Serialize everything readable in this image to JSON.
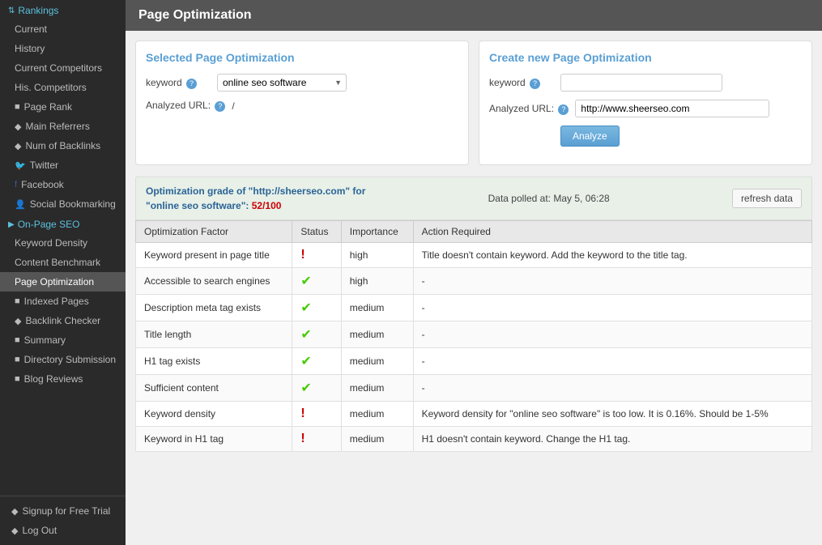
{
  "sidebar": {
    "rankings_label": "Rankings",
    "current_label": "Current",
    "history_label": "History",
    "current_competitors_label": "Current Competitors",
    "his_competitors_label": "His. Competitors",
    "page_rank_label": "Page Rank",
    "main_referrers_label": "Main Referrers",
    "num_backlinks_label": "Num of Backlinks",
    "twitter_label": "Twitter",
    "facebook_label": "Facebook",
    "social_bookmarking_label": "Social Bookmarking",
    "onpage_seo_label": "On-Page SEO",
    "keyword_density_label": "Keyword Density",
    "content_benchmark_label": "Content Benchmark",
    "page_optimization_label": "Page Optimization",
    "indexed_pages_label": "Indexed Pages",
    "backlink_checker_label": "Backlink Checker",
    "summary_label": "Summary",
    "directory_submission_label": "Directory Submission",
    "blog_reviews_label": "Blog Reviews",
    "signup_label": "Signup for Free Trial",
    "logout_label": "Log Out"
  },
  "page_header": "Page Optimization",
  "selected_panel": {
    "title": "Selected Page Optimization",
    "keyword_label": "keyword",
    "keyword_value": "online seo software",
    "analyzed_url_label": "Analyzed URL:",
    "analyzed_url_value": "/"
  },
  "create_panel": {
    "title": "Create new Page Optimization",
    "keyword_label": "keyword",
    "keyword_placeholder": "",
    "analyzed_url_label": "Analyzed URL:",
    "analyzed_url_value": "http://www.sheerseo.com",
    "analyze_btn": "Analyze"
  },
  "grade_section": {
    "grade_line1": "Optimization grade of \"http://sheerseo.com\" for",
    "grade_line2_pre": "\"online seo software\": ",
    "grade_score": "52/100",
    "poll_label": "Data polled at: May 5, 06:28",
    "refresh_btn": "refresh data"
  },
  "table": {
    "headers": [
      "Optimization Factor",
      "Status",
      "Importance",
      "Action Required"
    ],
    "rows": [
      {
        "factor": "Keyword present in page title",
        "status": "error",
        "importance": "high",
        "action": "Title doesn't contain keyword. Add the keyword to the title tag."
      },
      {
        "factor": "Accessible to search engines",
        "status": "ok",
        "importance": "high",
        "action": "-"
      },
      {
        "factor": "Description meta tag exists",
        "status": "ok",
        "importance": "medium",
        "action": "-"
      },
      {
        "factor": "Title length",
        "status": "ok",
        "importance": "medium",
        "action": "-"
      },
      {
        "factor": "H1 tag exists",
        "status": "ok",
        "importance": "medium",
        "action": "-"
      },
      {
        "factor": "Sufficient content",
        "status": "ok",
        "importance": "medium",
        "action": "-"
      },
      {
        "factor": "Keyword density",
        "status": "error",
        "importance": "medium",
        "action": "Keyword density for \"online seo software\" is too low. It is 0.16%. Should be 1-5%"
      },
      {
        "factor": "Keyword in H1 tag",
        "status": "error",
        "importance": "medium",
        "action": "H1 doesn't contain keyword. Change the H1 tag."
      }
    ]
  }
}
